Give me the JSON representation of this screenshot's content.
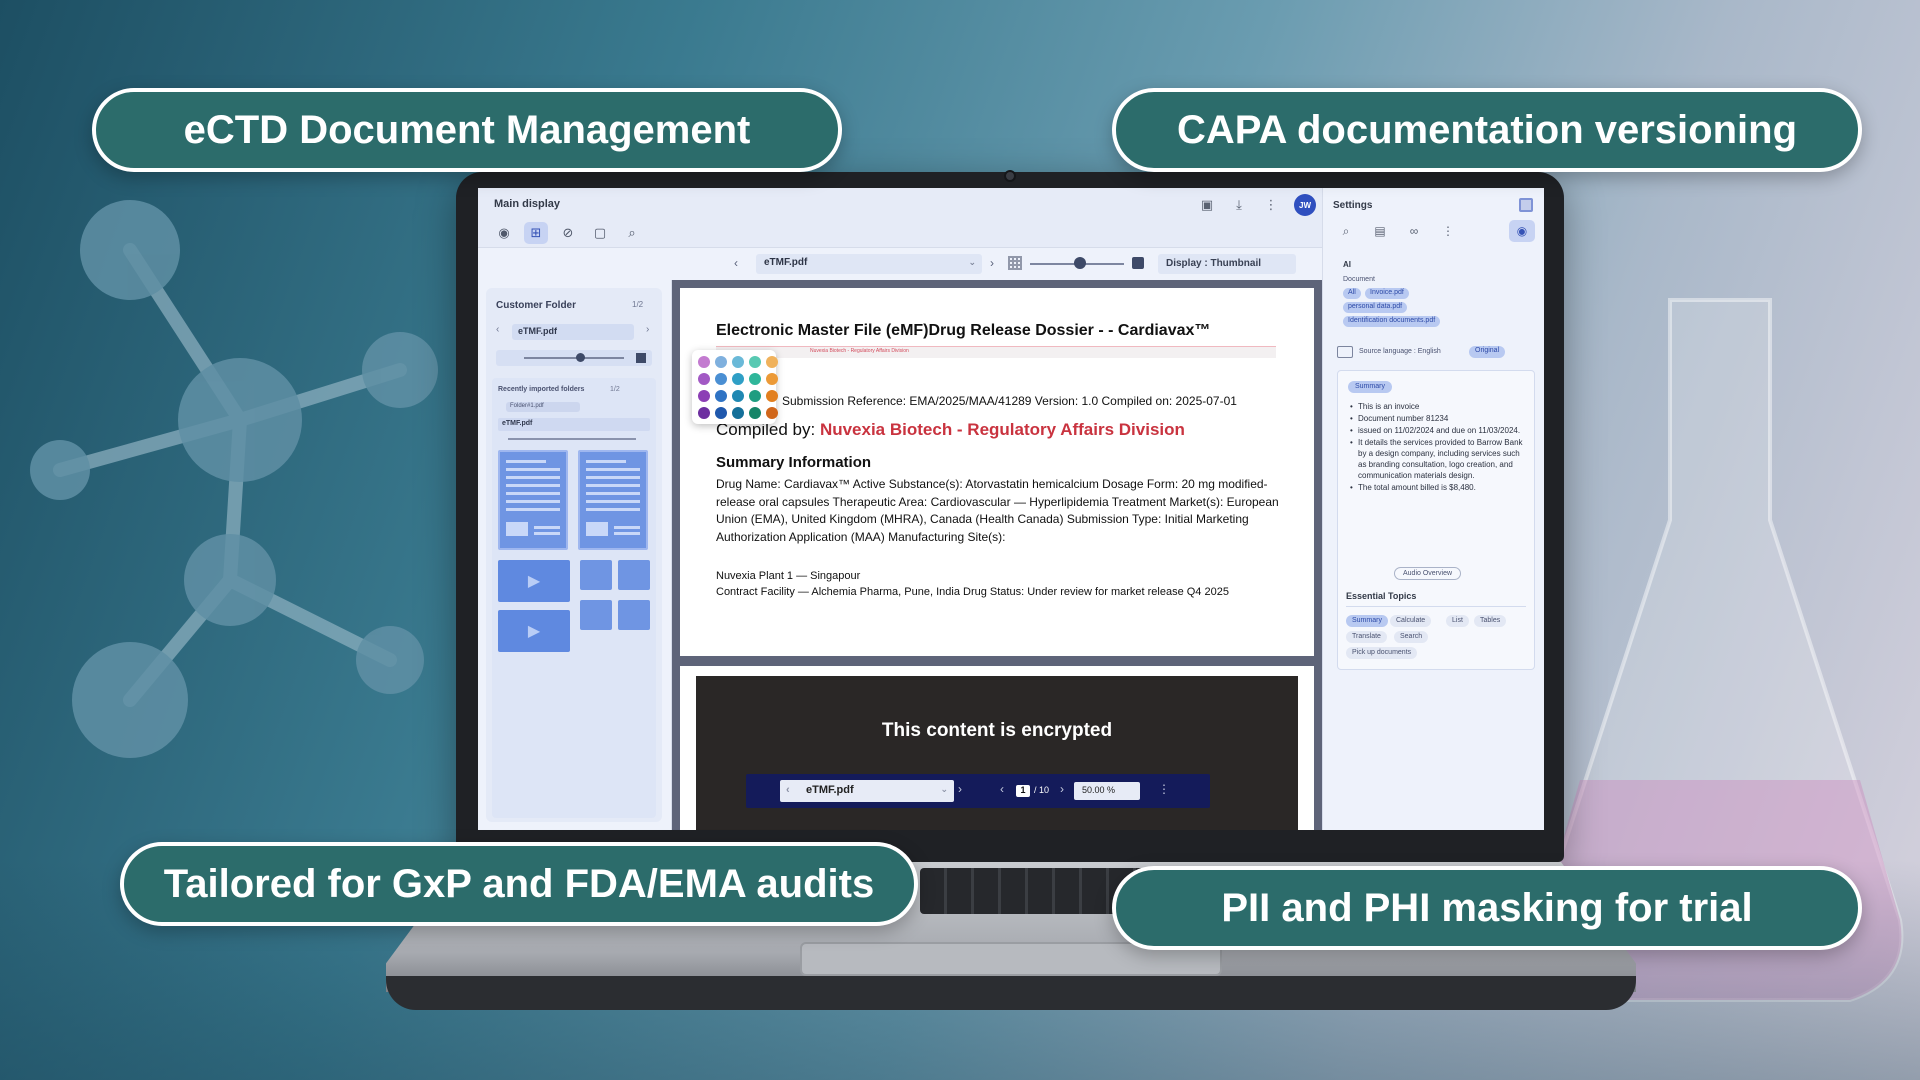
{
  "pills": {
    "top_left": "eCTD Document Management",
    "top_right": "CAPA documentation versioning",
    "bottom_left": "Tailored for GxP and FDA/EMA audits",
    "bottom_right": "PII and PHI masking for trial"
  },
  "colors": {
    "pill_bg": "#2c6c6b",
    "accent": "#2f4fbf",
    "highlight_red": "#c9333f"
  },
  "main_display": {
    "title": "Main display",
    "avatar_initials": "JW",
    "tools": [
      "eye-icon",
      "grid-icon",
      "pen-slash-icon",
      "note-icon",
      "search-icon"
    ],
    "header_icons": [
      "save-icon",
      "download-icon",
      "more-icon"
    ]
  },
  "file_bar": {
    "file_name": "eTMF.pdf",
    "display_label": "Display : Thumbnail"
  },
  "left_panel": {
    "title": "Customer Folder",
    "count": "1/2",
    "file_name": "eTMF.pdf",
    "recent_title": "Recently imported folders",
    "recent_count": "1/2",
    "chip": "Folder#1.pdf",
    "recent_file": "eTMF.pdf"
  },
  "document": {
    "title": "Electronic Master File (eMF)Drug Release Dossier - - Cardiavax™",
    "redline_text": "Nuvexia Biotech - Regulatory Affairs Division",
    "reference": "Submission Reference: EMA/2025/MAA/41289 Version: 1.0 Compiled on: 2025-07-01",
    "compiled_prefix": "Compiled by: ",
    "compiled_by": "Nuvexia Biotech - Regulatory Affairs Division",
    "summary_heading": "Summary Information",
    "summary_body": "Drug Name: Cardiavax™ Active Substance(s): Atorvastatin hemicalcium Dosage Form: 20 mg modified-release oral capsules Therapeutic Area: Cardiovascular — Hyperlipidemia Treatment Market(s): European Union (EMA), United Kingdom (MHRA), Canada (Health Canada) Submission Type: Initial Marketing Authorization Application (MAA) Manufacturing Site(s):",
    "plant": "Nuvexia Plant 1 — Singapour",
    "contract": "Contract Facility — Alchemia Pharma, Pune, India Drug Status: Under review for market release Q4 2025",
    "swatch_colors": [
      "#c37bd0",
      "#7fb0de",
      "#6ab9d8",
      "#58c9b2",
      "#f0b25c",
      "#a259c4",
      "#4a8fd3",
      "#2f9fc6",
      "#2fb69a",
      "#ec9a37",
      "#8c3fb5",
      "#2f73c4",
      "#1f88b2",
      "#1e9d80",
      "#e27f1e",
      "#6d2fa0",
      "#1f58ad",
      "#14709a",
      "#168568",
      "#d0661a"
    ]
  },
  "encrypted": {
    "message": "This content is encrypted",
    "file_name": "eTMF.pdf",
    "page": "1",
    "total": "/ 10",
    "zoom": "50.00 %"
  },
  "settings": {
    "title": "Settings",
    "ai_label": "AI",
    "document_label": "Document",
    "doc_chips": [
      "All",
      "Invoice.pdf",
      "personal data.pdf",
      "Identification documents.pdf"
    ],
    "source_language": "Source language : English",
    "original_label": "Original",
    "summary_chip": "Summary",
    "summary_items": [
      "This is an invoice",
      "Document number 81234",
      "issued on 11/02/2024 and due on 11/03/2024.",
      "It details the services provided to Barrow Bank by a design company, including services such as branding consultation, logo creation, and communication materials design.",
      "The total amount billed is $8,480."
    ],
    "audio_overview": "Audio Overview",
    "essential_topics": "Essential Topics",
    "topics": [
      "Summary",
      "Calculate",
      "List",
      "Tables",
      "Translate",
      "Search",
      "Pick up documents"
    ]
  }
}
